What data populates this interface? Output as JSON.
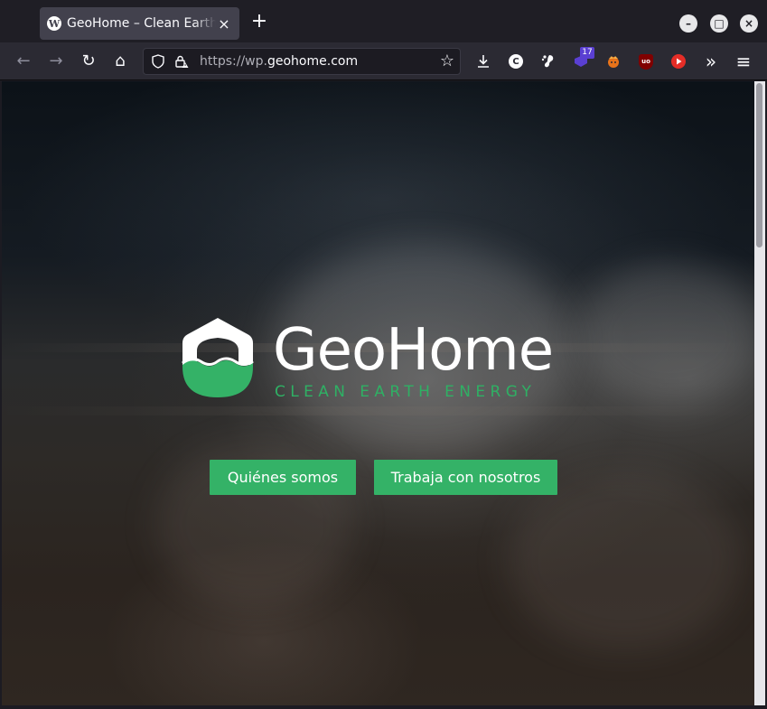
{
  "browser": {
    "tab": {
      "title": "GeoHome – Clean Earth Energy",
      "favicon_letter": "W"
    },
    "new_tab_label": "+",
    "window_controls": {
      "minimize": "–",
      "maximize": "□",
      "close": "×"
    },
    "nav": {
      "back": "←",
      "forward": "→",
      "reload": "↻",
      "home": "⌂"
    },
    "url": {
      "scheme": "https://wp.",
      "host": "geohome.com"
    },
    "extensions": {
      "ext_badge_count": "17",
      "ublock_label": "uo",
      "c_label": "C"
    },
    "overflow_label": "»",
    "menu_label": "≡"
  },
  "page": {
    "brand": {
      "name": "GeoHome",
      "tagline": "CLEAN EARTH ENERGY"
    },
    "buttons": {
      "about": "Quiénes somos",
      "careers": "Trabaja con nosotros"
    }
  },
  "colors": {
    "brand_green": "#34b267",
    "tagline_green": "#2fb064",
    "toolbar_bg": "#2b2a33",
    "titlebar_bg": "#1f1e25"
  },
  "icons": [
    "wordpress-icon",
    "shield-icon",
    "lock-warning-icon",
    "star-icon",
    "download-icon",
    "gnome-icon",
    "ublock-icon",
    "youtube-icon",
    "hamburger-menu-icon"
  ]
}
